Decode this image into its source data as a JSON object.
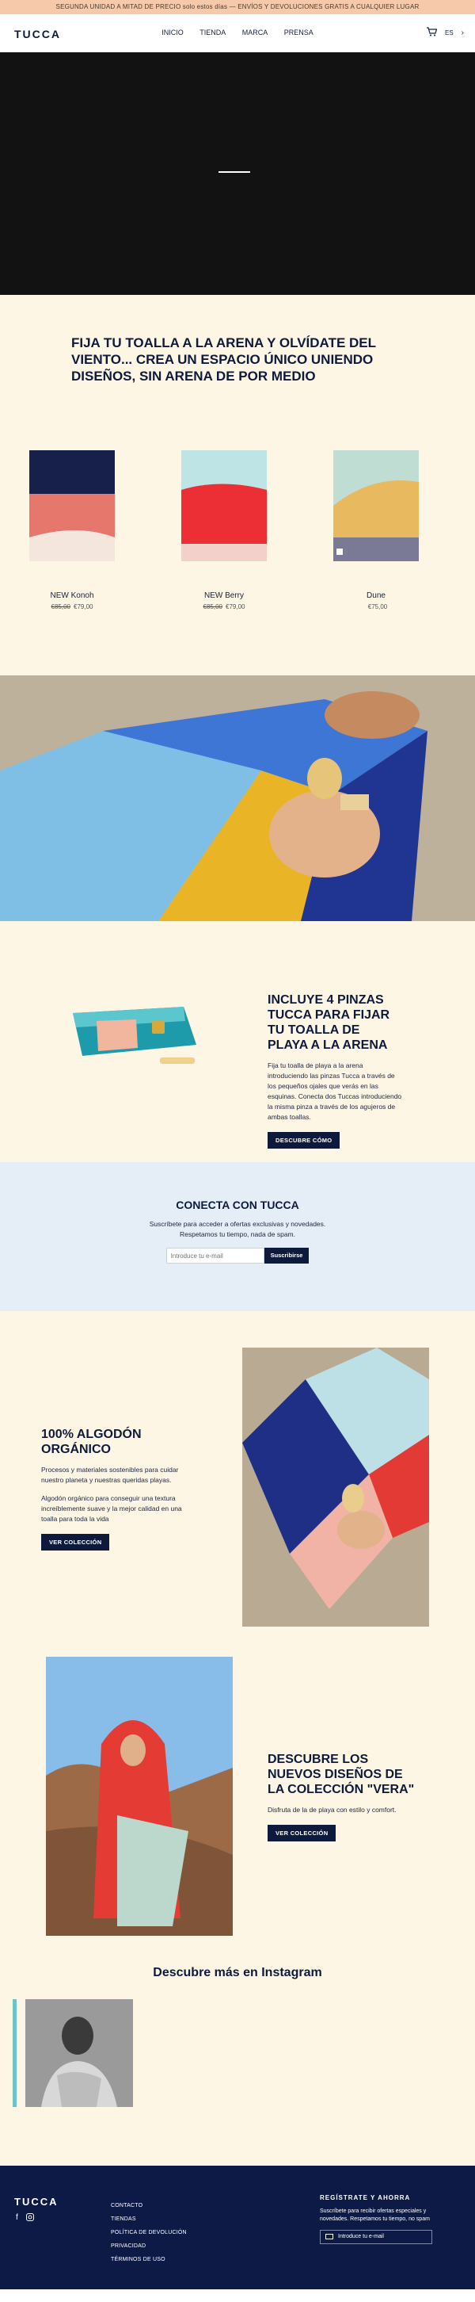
{
  "announcement": "SEGUNDA UNIDAD A MITAD DE PRECIO solo estos días — ENVÍOS Y DEVOLUCIONES GRATIS A CUALQUIER LUGAR",
  "header": {
    "logo": "TUCCA",
    "nav": [
      "INICIO",
      "TIENDA",
      "MARCA",
      "PRENSA"
    ],
    "lang": "ES",
    "cart_icon": "cart-icon",
    "arrow_icon": "chevron-right-icon"
  },
  "intro": {
    "heading": "FIJA TU TOALLA A LA ARENA Y OLVÍDATE DEL VIENTO... CREA UN ESPACIO ÚNICO UNIENDO DISEÑOS, SIN ARENA DE POR MEDIO"
  },
  "products": [
    {
      "name": "NEW Konoh",
      "old_price": "€85,00",
      "price": "€79,00"
    },
    {
      "name": "NEW Berry",
      "old_price": "€85,00",
      "price": "€79,00"
    },
    {
      "name": "Dune",
      "old_price": "",
      "price": "€75,00"
    }
  ],
  "pinzas": {
    "title": "INCLUYE 4 PINZAS TUCCA PARA FIJAR TU TOALLA DE PLAYA A LA ARENA",
    "body": "Fija tu toalla de playa a la arena introduciendo las pinzas Tucca a través de los pequeños ojales que verás en las esquinas. Conecta dos Tuccas introduciendo la misma pinza a través de los agujeros de ambas toallas.",
    "button": "DESCUBRE CÓMO"
  },
  "newsletter": {
    "title": "CONECTA CON TUCCA",
    "line1": "Suscríbete para acceder a ofertas exclusivas y novedades.",
    "line2": "Respetamos tu tiempo, nada de spam.",
    "placeholder": "Introduce tu e-mail",
    "button": "Suscribirse"
  },
  "algodon": {
    "title": "100% ALGODÓN ORGÁNICO",
    "p1": "Procesos y materiales sostenibles para cuidar nuestro planeta y nuestras queridas playas.",
    "p2": "Algodón orgánico para conseguir una textura increíblemente suave y la mejor calidad en una toalla para toda la vida",
    "button": "VER COLECCIÓN"
  },
  "vera": {
    "title": "DESCUBRE LOS NUEVOS DISEÑOS DE LA COLECCIÓN \"VERA\"",
    "body": "Disfruta de la de playa con estilo y comfort.",
    "button": "VER COLECCIÓN"
  },
  "instagram": {
    "title": "Descubre más en Instagram"
  },
  "footer": {
    "logo": "TUCCA",
    "links": [
      "CONTACTO",
      "TIENDAS",
      "POLÍTICA DE DEVOLUCIÓN",
      "PRIVACIDAD",
      "TÉRMINOS DE USO"
    ],
    "signup_title": "REGÍSTRATE Y AHORRA",
    "signup_body": "Suscríbete para recibir ofertas especiales y novedades. Respetamos tu tiempo, no spam",
    "signup_placeholder": "Introduce tu e-mail"
  }
}
